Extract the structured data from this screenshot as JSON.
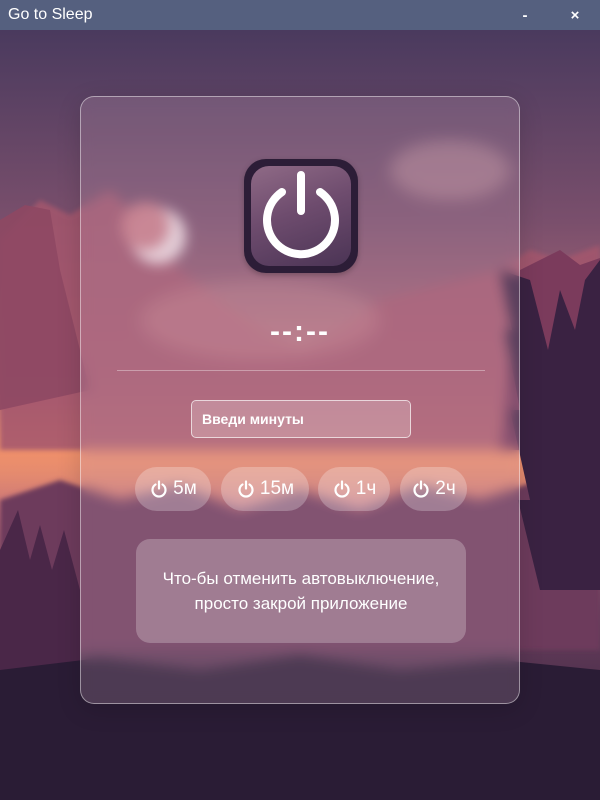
{
  "window": {
    "title": "Go to Sleep",
    "minimize_label": "-",
    "close_label": "×"
  },
  "colors": {
    "titlebar": "#55607f",
    "sky_top": "#4a3a5e",
    "sky_mid": "#b56a78",
    "horizon": "#e98a6a",
    "ground": "#2a1c35"
  },
  "logo": {
    "icon": "power-icon"
  },
  "timer": {
    "display": "--:--"
  },
  "input": {
    "placeholder": "Введи минуты",
    "value": ""
  },
  "quick_buttons": [
    {
      "icon": "power-icon",
      "label": "5м"
    },
    {
      "icon": "power-icon",
      "label": "15м"
    },
    {
      "icon": "power-icon",
      "label": "1ч"
    },
    {
      "icon": "power-icon",
      "label": "2ч"
    }
  ],
  "hint": {
    "text": "Что-бы отменить автовыключение, просто закрой приложение"
  }
}
